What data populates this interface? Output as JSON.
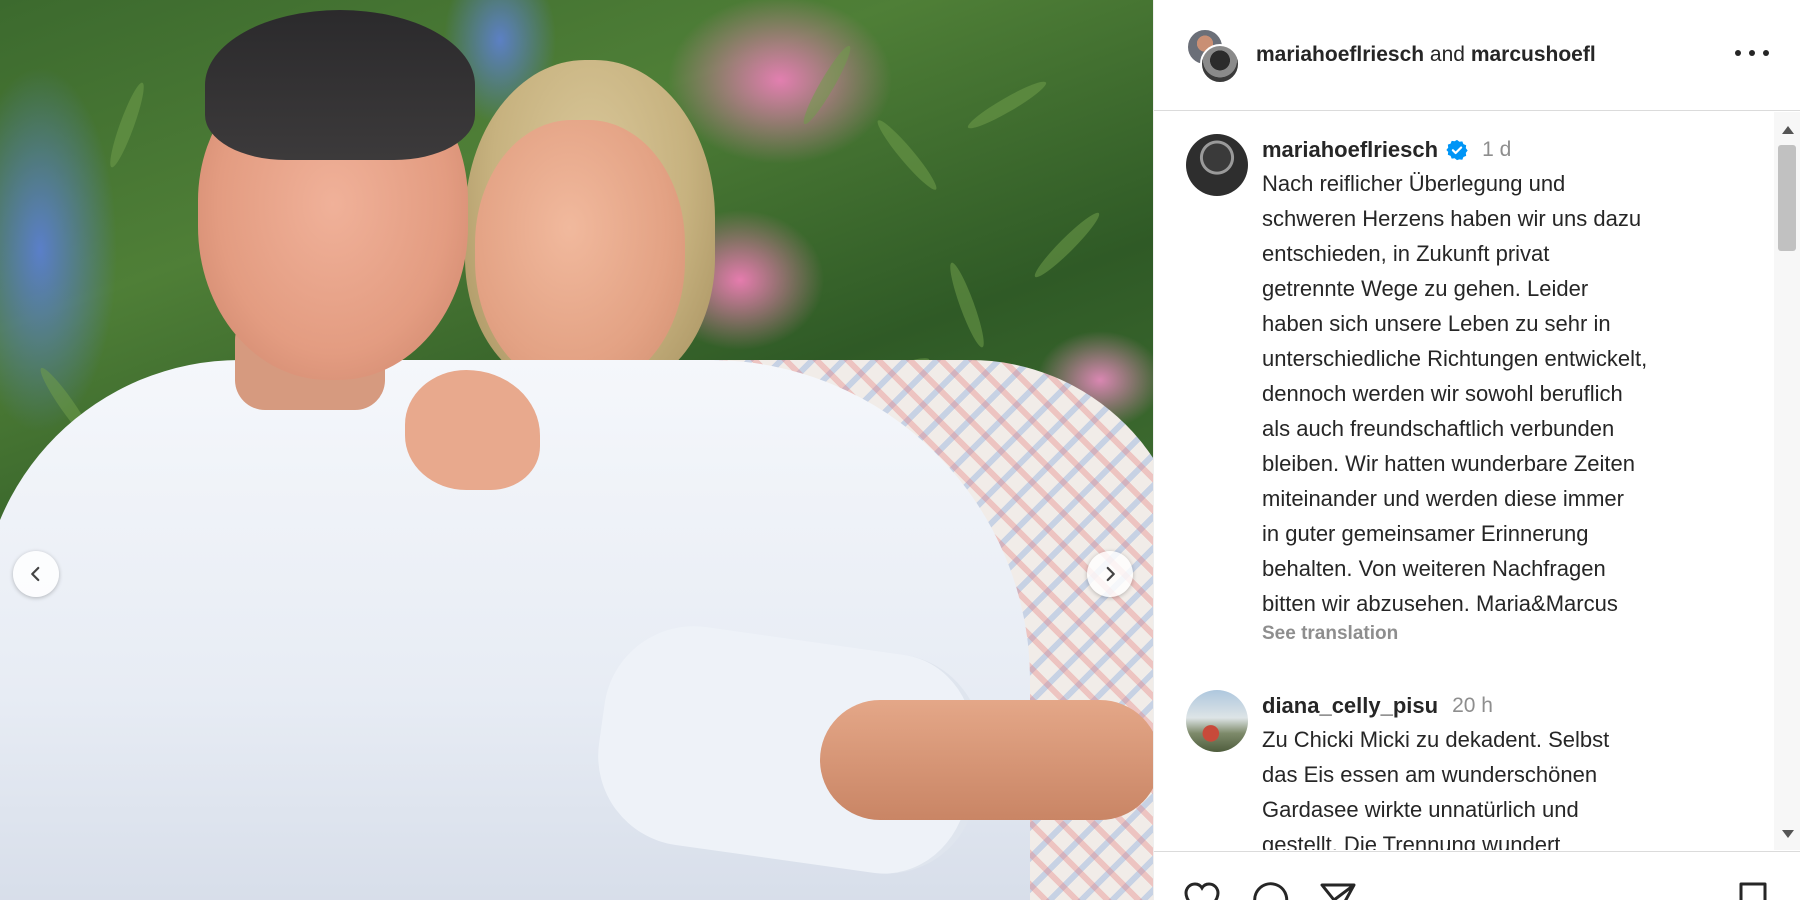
{
  "post": {
    "header_user_1": "mariahoeflriesch",
    "header_and": "and",
    "header_user_2": "marcushoefl",
    "caption": {
      "username": "mariahoeflriesch",
      "time": "1 d",
      "text": "Nach reiflicher Überlegung und\nschweren Herzens haben wir uns dazu\nentschieden, in Zukunft privat\ngetrennte Wege zu gehen. Leider\nhaben sich unsere Leben zu sehr in\nunterschiedliche Richtungen entwickelt,\ndennoch werden wir sowohl beruflich\nals auch freundschaftlich verbunden\nbleiben. Wir hatten wunderbare Zeiten\nmiteinander und werden diese immer\nin guter gemeinsamer Erinnerung\nbehalten. Von weiteren Nachfragen\nbitten wir abzusehen. Maria&Marcus",
      "see_translation": "See translation"
    },
    "comment": {
      "username": "diana_celly_pisu",
      "time": "20 h",
      "text": "Zu Chicki Micki zu dekadent. Selbst\ndas Eis essen am wunderschönen\nGardasee wirkte unnatürlich und\ngestellt. Die Trennung wundert"
    }
  },
  "colors": {
    "verified": "#0095f6",
    "muted": "#8e8e8e",
    "text": "#262626",
    "divider": "#dbdbdb"
  },
  "icons": {
    "prev": "chevron-left-icon",
    "next": "chevron-right-icon",
    "more": "more-horizontal-icon",
    "like": "heart-icon",
    "comment": "comment-icon",
    "share": "paper-plane-icon",
    "save": "bookmark-icon"
  }
}
